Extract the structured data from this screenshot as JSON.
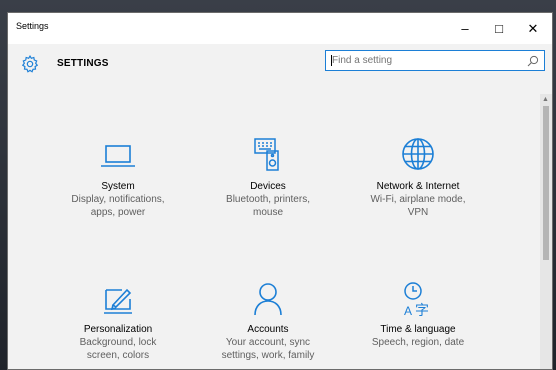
{
  "window": {
    "title": "Settings",
    "controls": {
      "minimize": "–",
      "maximize": "□",
      "close": "✕"
    }
  },
  "header": {
    "heading": "SETTINGS",
    "search": {
      "placeholder": "Find a setting",
      "value": ""
    }
  },
  "accent_color": "#1c7fd6",
  "tiles": [
    {
      "icon": "laptop-icon",
      "name": "System",
      "desc": "Display, notifications,\napps, power"
    },
    {
      "icon": "devices-icon",
      "name": "Devices",
      "desc": "Bluetooth, printers,\nmouse"
    },
    {
      "icon": "globe-icon",
      "name": "Network & Internet",
      "desc": "Wi-Fi, airplane mode,\nVPN"
    },
    {
      "icon": "personalization-icon",
      "name": "Personalization",
      "desc": "Background, lock\nscreen, colors"
    },
    {
      "icon": "person-icon",
      "name": "Accounts",
      "desc": "Your account, sync\nsettings, work, family"
    },
    {
      "icon": "time-language-icon",
      "name": "Time & language",
      "desc": "Speech, region, date"
    }
  ]
}
